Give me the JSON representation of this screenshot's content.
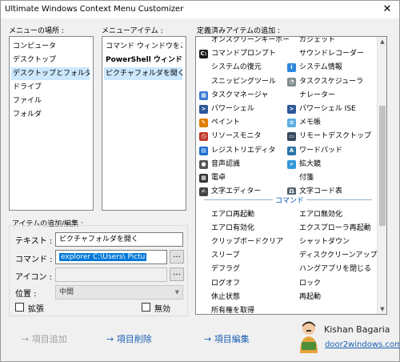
{
  "window": {
    "title": "Ultimate Windows Context Menu Customizer",
    "close_glyph": "✕"
  },
  "location_panel": {
    "label": "メニューの場所 :",
    "items": [
      "コンピュータ",
      "デスクトップ",
      "デスクトップとフォルダ",
      "ドライブ",
      "ファイル",
      "フォルダ"
    ],
    "selected_index": 2
  },
  "menu_items_panel": {
    "label": "メニューアイテム :",
    "items": [
      "コマンド ウィンドウをここ...",
      "PowerShell ウィンドウ...",
      "ピクチャフォルダを開く"
    ],
    "selected_index": 2
  },
  "predefined_panel": {
    "label": "定義済みアイテムの追加 :",
    "left_column": [
      {
        "text": "オンスクリーンキーボード",
        "icon": "keyboard-icon",
        "color": ""
      },
      {
        "text": "コマンドプロンプト",
        "icon": "cmd-icon",
        "color": "#1b1b1b"
      },
      {
        "text": "システムの復元",
        "icon": "",
        "color": ""
      },
      {
        "text": "スニッピングツール",
        "icon": "",
        "color": ""
      },
      {
        "text": "タスクマネージャ",
        "icon": "task-manager-icon",
        "color": "#3a7bd5"
      },
      {
        "text": "パワーシェル",
        "icon": "powershell-icon",
        "color": "#2b5797"
      },
      {
        "text": "ペイント",
        "icon": "paint-icon",
        "color": "#e07b00"
      },
      {
        "text": "リソースモニタ",
        "icon": "resource-monitor-icon",
        "color": "#c0392b"
      },
      {
        "text": "レジストリエディタ",
        "icon": "registry-icon",
        "color": "#1f6fd1"
      },
      {
        "text": "音声認識",
        "icon": "microphone-icon",
        "color": "#555555"
      },
      {
        "text": "電卓",
        "icon": "calculator-icon",
        "color": "#333333"
      },
      {
        "text": "文字エディター",
        "icon": "text-editor-icon",
        "color": "#444444"
      }
    ],
    "right_column": [
      {
        "text": "ガジェット",
        "icon": "",
        "color": ""
      },
      {
        "text": "サウンドレコーダー",
        "icon": "",
        "color": ""
      },
      {
        "text": "システム情報",
        "icon": "system-info-icon",
        "color": "#2e86de"
      },
      {
        "text": "タスクスケジューラ",
        "icon": "clock-icon",
        "color": "#7f8c8d"
      },
      {
        "text": "ナレーター",
        "icon": "",
        "color": ""
      },
      {
        "text": "パワーシェル ISE",
        "icon": "powershell-ise-icon",
        "color": "#2b5797"
      },
      {
        "text": "メモ帳",
        "icon": "notepad-icon",
        "color": "#5dade2"
      },
      {
        "text": "リモートデスクトップ",
        "icon": "remote-desktop-icon",
        "color": "#34495e"
      },
      {
        "text": "ワードパッド",
        "icon": "wordpad-icon",
        "color": "#2874a6"
      },
      {
        "text": "拡大鏡",
        "icon": "magnifier-icon",
        "color": "#3498db"
      },
      {
        "text": "付箋",
        "icon": "",
        "color": ""
      },
      {
        "text": "文字コード表",
        "icon": "charmap-icon",
        "color": "#566573"
      }
    ],
    "section_label": "コマンド",
    "command_left": [
      "エアロ再起動",
      "エアロ有効化",
      "クリップボードクリア",
      "スリープ",
      "デフラグ",
      "ログオフ",
      "休止状態",
      "所有権を取得"
    ],
    "command_right": [
      "エアロ無効化",
      "エクスプローラ再起動",
      "シャットダウン",
      "ディスククリーンアップ",
      "ハングアプリを閉じる",
      "ロック",
      "再起動"
    ]
  },
  "edit_panel": {
    "label": "アイテムの追加/編集 :",
    "text_label": "テキスト :",
    "text_value": "ピクチャフォルダを開く",
    "command_label": "コマンド :",
    "command_value": "explorer C:\\Users\\        Pictu",
    "icon_label": "アイコン :",
    "icon_value": "",
    "position_label": "位置 :",
    "position_value": "中間",
    "browse_label": "...",
    "extended_label": "拡張",
    "disabled_label": "無効"
  },
  "actions": {
    "add": "→ 項目追加",
    "remove": "→ 項目削除",
    "edit": "→ 項目編集"
  },
  "author": {
    "name": "Kishan Bagaria",
    "site": "door2windows.com"
  },
  "colors": {
    "accent": "#1a5fb4",
    "selection": "#cce8ff",
    "text_selection": "#0078d7"
  }
}
